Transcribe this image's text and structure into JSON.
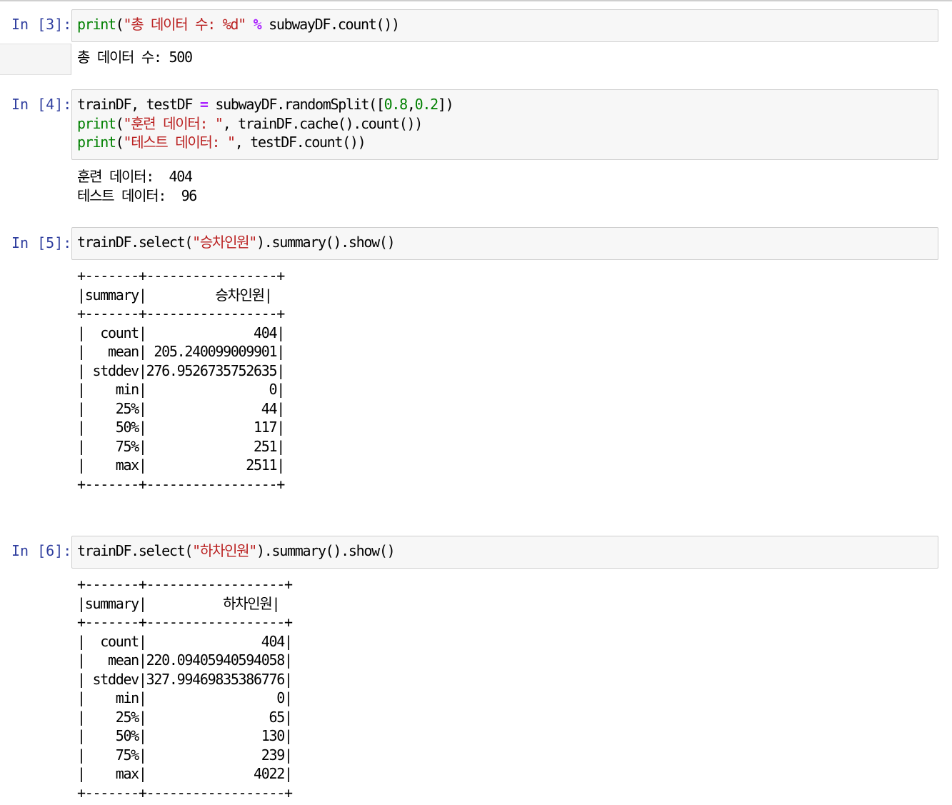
{
  "cells": [
    {
      "prompt": "In [3]:",
      "code": [
        [
          {
            "t": "print",
            "c": "kw"
          },
          {
            "t": "(",
            "c": ""
          },
          {
            "t": "\"총 데이터 수: %d\"",
            "c": "str"
          },
          {
            "t": " ",
            "c": ""
          },
          {
            "t": "%",
            "c": "op"
          },
          {
            "t": " subwayDF.count())",
            "c": ""
          }
        ]
      ],
      "output": [
        "총 데이터 수: 500"
      ]
    },
    {
      "prompt": "In [4]:",
      "code": [
        [
          {
            "t": "trainDF, testDF ",
            "c": ""
          },
          {
            "t": "=",
            "c": "op"
          },
          {
            "t": " subwayDF.randomSplit([",
            "c": ""
          },
          {
            "t": "0.8",
            "c": "num"
          },
          {
            "t": ",",
            "c": ""
          },
          {
            "t": "0.2",
            "c": "num"
          },
          {
            "t": "])",
            "c": ""
          }
        ],
        [
          {
            "t": "print",
            "c": "kw"
          },
          {
            "t": "(",
            "c": ""
          },
          {
            "t": "\"훈련 데이터: \"",
            "c": "str"
          },
          {
            "t": ", trainDF.cache().count())",
            "c": ""
          }
        ],
        [
          {
            "t": "print",
            "c": "kw"
          },
          {
            "t": "(",
            "c": ""
          },
          {
            "t": "\"테스트 데이터: \"",
            "c": "str"
          },
          {
            "t": ", testDF.count())",
            "c": ""
          }
        ]
      ],
      "output": [
        "훈련 데이터:  404",
        "테스트 데이터:  96"
      ]
    },
    {
      "prompt": "In [5]:",
      "code": [
        [
          {
            "t": "trainDF.select(",
            "c": ""
          },
          {
            "t": "\"승차인원\"",
            "c": "str"
          },
          {
            "t": ").summary().show()",
            "c": ""
          }
        ]
      ],
      "output": [
        "+-------+-----------------+",
        "|summary|         승차인원|",
        "+-------+-----------------+",
        "|  count|              404|",
        "|   mean| 205.240099009901|",
        "| stddev|276.9526735752635|",
        "|    min|                0|",
        "|    25%|               44|",
        "|    50%|              117|",
        "|    75%|              251|",
        "|    max|             2511|",
        "+-------+-----------------+"
      ]
    },
    {
      "prompt": "In [6]:",
      "code": [
        [
          {
            "t": "trainDF.select(",
            "c": ""
          },
          {
            "t": "\"하차인원\"",
            "c": "str"
          },
          {
            "t": ").summary().show()",
            "c": ""
          }
        ]
      ],
      "output": [
        "+-------+------------------+",
        "|summary|          하차인원|",
        "+-------+------------------+",
        "|  count|               404|",
        "|   mean|220.09405940594058|",
        "| stddev|327.99469835386776|",
        "|    min|                 0|",
        "|    25%|                65|",
        "|    50%|               130|",
        "|    75%|               239|",
        "|    max|              4022|",
        "+-------+------------------+"
      ]
    }
  ]
}
